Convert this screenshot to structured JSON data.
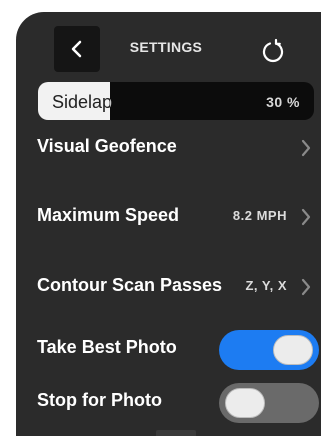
{
  "header": {
    "title": "SETTINGS",
    "back_icon": "chevron-left-icon",
    "reset_icon": "refresh-icon"
  },
  "sidelap": {
    "label": "Sidelap",
    "value": "30 %",
    "fill_fraction": 0.26
  },
  "rows": {
    "visual_geofence": {
      "label": "Visual Geofence"
    },
    "maximum_speed": {
      "label": "Maximum Speed",
      "value": "8.2 MPH"
    },
    "contour_scan": {
      "label": "Contour Scan Passes",
      "value": "Z, Y, X"
    },
    "take_best_photo": {
      "label": "Take Best Photo",
      "enabled": true
    },
    "stop_for_photo": {
      "label": "Stop for Photo",
      "enabled": false
    }
  },
  "colors": {
    "panel": "#2b2b2b",
    "toggle_on": "#1d7cf2",
    "toggle_off": "#6a6a6a"
  }
}
